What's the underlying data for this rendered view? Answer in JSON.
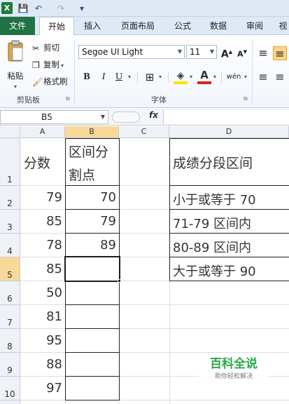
{
  "titlebar": {
    "excel_logo": "X",
    "save_icon": "💾",
    "undo_icon": "↶",
    "redo_icon": "↷",
    "customize_icon": "▾"
  },
  "tabs": [
    "文件",
    "开始",
    "插入",
    "页面布局",
    "公式",
    "数据",
    "审阅",
    "视"
  ],
  "ribbon": {
    "clipboard": {
      "paste": "粘贴",
      "cut": "剪切",
      "copy": "复制",
      "format_painter": "格式刷",
      "group_label": "剪贴板"
    },
    "font": {
      "font_name": "Segoe UI Light",
      "font_size": "11",
      "grow": "A",
      "shrink": "A",
      "bold": "B",
      "italic": "I",
      "underline": "U",
      "border": "⊞",
      "fill_color": "◈",
      "font_color": "A",
      "phonetic": "wén",
      "group_label": "字体"
    },
    "alignment": {
      "top_align": "≡",
      "middle_align": "≡",
      "left_align": "≡",
      "center_align": "≡"
    }
  },
  "formula_bar": {
    "name_box": "B5",
    "fx": "fx",
    "value": ""
  },
  "columns": [
    "A",
    "B",
    "C",
    "D"
  ],
  "rows": [
    "1",
    "2",
    "3",
    "4",
    "5",
    "6",
    "7",
    "8",
    "9",
    "10"
  ],
  "cells": {
    "A1": "分数",
    "B1_line1": "区间分",
    "B1_line2": "割点",
    "D1": "成绩分段区间",
    "A2": "79",
    "A3": "85",
    "A4": "78",
    "A5": "85",
    "A6": "50",
    "A7": "81",
    "A8": "95",
    "A9": "88",
    "A10": "97",
    "B2": "70",
    "B3": "79",
    "B4": "89",
    "D2": "小于或等于 70",
    "D3": "71-79 区间内",
    "D4": "80-89 区间内",
    "D5": "大于或等于 90"
  },
  "selected_cell": "B5",
  "watermark": {
    "title": "百科全说",
    "subtitle": "助你轻松解决"
  }
}
